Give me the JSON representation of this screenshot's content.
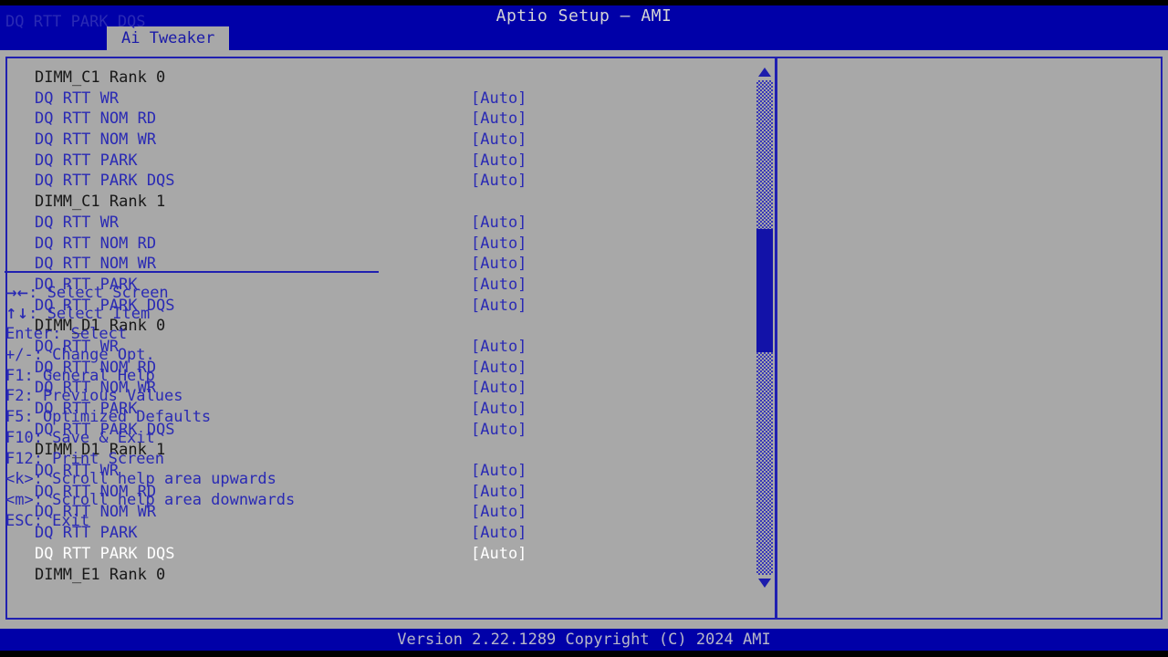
{
  "header": {
    "title": "Aptio Setup – AMI",
    "tabs": [
      {
        "label": "Ai Tweaker",
        "active": true
      }
    ]
  },
  "colors": {
    "header_blue": "#0000a8",
    "panel_gray": "#a8a8a8",
    "border_blue": "#2020b0",
    "item_blue": "#2a2ab4",
    "header_text": "#181818",
    "selected_white": "#ffffff",
    "scrollbar_thumb": "#1212a8"
  },
  "main": {
    "rows": [
      {
        "type": "header",
        "label": "DIMM_C1 Rank 0",
        "value": "",
        "selected": false
      },
      {
        "type": "item",
        "label": "DQ RTT WR",
        "value": "[Auto]",
        "selected": false
      },
      {
        "type": "item",
        "label": "DQ RTT NOM RD",
        "value": "[Auto]",
        "selected": false
      },
      {
        "type": "item",
        "label": "DQ RTT NOM WR",
        "value": "[Auto]",
        "selected": false
      },
      {
        "type": "item",
        "label": "DQ RTT PARK",
        "value": "[Auto]",
        "selected": false
      },
      {
        "type": "item",
        "label": "DQ RTT PARK DQS",
        "value": "[Auto]",
        "selected": false
      },
      {
        "type": "header",
        "label": "DIMM_C1 Rank 1",
        "value": "",
        "selected": false
      },
      {
        "type": "item",
        "label": "DQ RTT WR",
        "value": "[Auto]",
        "selected": false
      },
      {
        "type": "item",
        "label": "DQ RTT NOM RD",
        "value": "[Auto]",
        "selected": false
      },
      {
        "type": "item",
        "label": "DQ RTT NOM WR",
        "value": "[Auto]",
        "selected": false
      },
      {
        "type": "item",
        "label": "DQ RTT PARK",
        "value": "[Auto]",
        "selected": false
      },
      {
        "type": "item",
        "label": "DQ RTT PARK DQS",
        "value": "[Auto]",
        "selected": false
      },
      {
        "type": "header",
        "label": "DIMM_D1 Rank 0",
        "value": "",
        "selected": false
      },
      {
        "type": "item",
        "label": "DQ RTT WR",
        "value": "[Auto]",
        "selected": false
      },
      {
        "type": "item",
        "label": "DQ RTT NOM RD",
        "value": "[Auto]",
        "selected": false
      },
      {
        "type": "item",
        "label": "DQ RTT NOM WR",
        "value": "[Auto]",
        "selected": false
      },
      {
        "type": "item",
        "label": "DQ RTT PARK",
        "value": "[Auto]",
        "selected": false
      },
      {
        "type": "item",
        "label": "DQ RTT PARK DQS",
        "value": "[Auto]",
        "selected": false
      },
      {
        "type": "header",
        "label": "DIMM_D1 Rank 1",
        "value": "",
        "selected": false
      },
      {
        "type": "item",
        "label": "DQ RTT WR",
        "value": "[Auto]",
        "selected": false
      },
      {
        "type": "item",
        "label": "DQ RTT NOM RD",
        "value": "[Auto]",
        "selected": false
      },
      {
        "type": "item",
        "label": "DQ RTT NOM WR",
        "value": "[Auto]",
        "selected": false
      },
      {
        "type": "item",
        "label": "DQ RTT PARK",
        "value": "[Auto]",
        "selected": false
      },
      {
        "type": "item",
        "label": "DQ RTT PARK DQS",
        "value": "[Auto]",
        "selected": true
      },
      {
        "type": "header",
        "label": "DIMM_E1 Rank 0",
        "value": "",
        "selected": false
      }
    ],
    "scrollbar": {
      "up_arrow_icon": "triangle-up-icon",
      "down_arrow_icon": "triangle-down-icon",
      "thumb_top_pct": 30,
      "thumb_height_pct": 25
    }
  },
  "help": {
    "description": "DQ RTT PARK DQS",
    "legend": [
      {
        "glyph": "→←",
        "text": ": Select Screen"
      },
      {
        "glyph": "↑↓",
        "text": ": Select Item"
      },
      {
        "glyph": "",
        "text": "Enter: Select"
      },
      {
        "glyph": "",
        "text": "+/-: Change Opt."
      },
      {
        "glyph": "",
        "text": "F1: General Help"
      },
      {
        "glyph": "",
        "text": "F2: Previous Values"
      },
      {
        "glyph": "",
        "text": "F5: Optimized Defaults"
      },
      {
        "glyph": "",
        "text": "F10: Save & Exit"
      },
      {
        "glyph": "",
        "text": "F12: Print Screen"
      },
      {
        "glyph": "",
        "text": "<k>: Scroll help area upwards"
      },
      {
        "glyph": "",
        "text": "<m>: Scroll help area downwards"
      },
      {
        "glyph": "",
        "text": "ESC: Exit"
      }
    ]
  },
  "footer": {
    "version_text": "Version 2.22.1289 Copyright (C) 2024 AMI"
  }
}
